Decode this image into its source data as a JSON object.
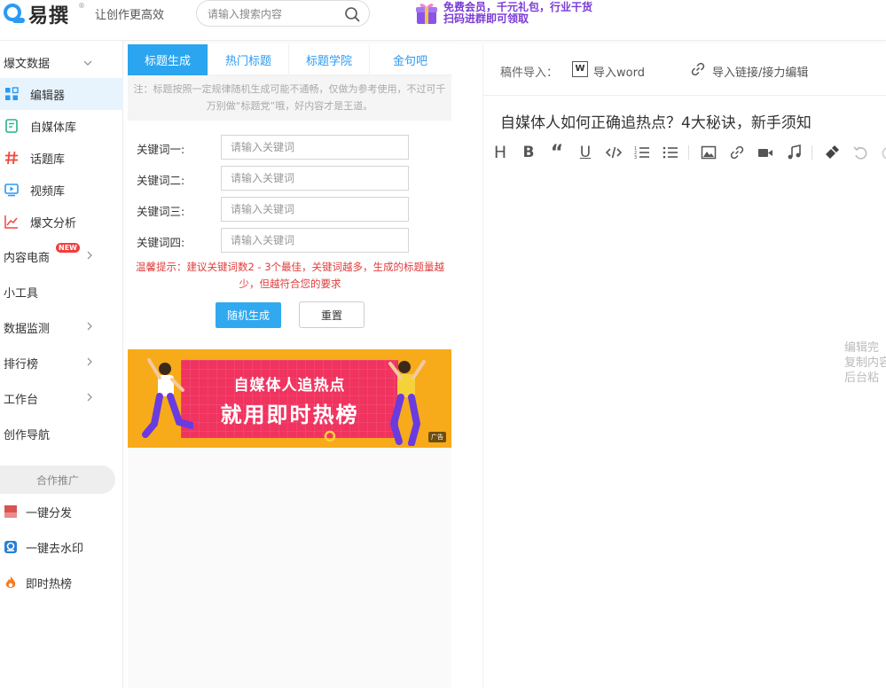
{
  "header": {
    "logo_text": "易撰",
    "logo_reg": "®",
    "slogan": "让创作更高效",
    "search_placeholder": "请输入搜索内容",
    "promo_line1": "免费会员，千元礼包，行业干货",
    "promo_line2": "扫码进群即可领取"
  },
  "sidebar": {
    "group1": {
      "label": "爆文数据"
    },
    "items": [
      {
        "label": "编辑器",
        "icon": "grid-icon",
        "active": true
      },
      {
        "label": "自媒体库",
        "icon": "document-icon"
      },
      {
        "label": "话题库",
        "icon": "hashtag-icon"
      },
      {
        "label": "视频库",
        "icon": "video-icon"
      },
      {
        "label": "爆文分析",
        "icon": "chart-line-icon"
      }
    ],
    "nav": [
      {
        "label": "内容电商",
        "badge": "NEW"
      },
      {
        "label": "小工具"
      },
      {
        "label": "数据监测"
      },
      {
        "label": "排行榜"
      },
      {
        "label": "工作台"
      },
      {
        "label": "创作导航"
      }
    ],
    "coop_label": "合作推广",
    "tools": [
      {
        "label": "一键分发"
      },
      {
        "label": "一键去水印"
      },
      {
        "label": "即时热榜"
      }
    ]
  },
  "title_gen": {
    "tabs": [
      "标题生成",
      "热门标题",
      "标题学院",
      "金句吧"
    ],
    "notice": "注：标题按照一定规律随机生成可能不通畅，仅做为参考使用，不过可千万别做“标题党”哦，好内容才是王道。",
    "keywords": [
      {
        "label": "关键词一:",
        "placeholder": "请输入关键词"
      },
      {
        "label": "关键词二:",
        "placeholder": "请输入关键词"
      },
      {
        "label": "关键词三:",
        "placeholder": "请输入关键词"
      },
      {
        "label": "关键词四:",
        "placeholder": "请输入关键词"
      }
    ],
    "tip": "温馨提示：建议关键词数2 - 3个最佳，关键词越多，生成的标题量越少，但越符合您的要求",
    "generate_label": "随机生成",
    "reset_label": "重置"
  },
  "ad": {
    "line1": "自媒体人追热点",
    "line2": "就用即时热榜",
    "tag": "广告"
  },
  "editor": {
    "import_label": "稿件导入：",
    "word_icon_letter": "W",
    "import_word": "导入word",
    "import_link": "导入链接/接力编辑",
    "title": "自媒体人如何正确追热点？4大秘诀，新手须知",
    "side_hint_lines": [
      "编辑完",
      "复制内容",
      "后台粘"
    ]
  }
}
